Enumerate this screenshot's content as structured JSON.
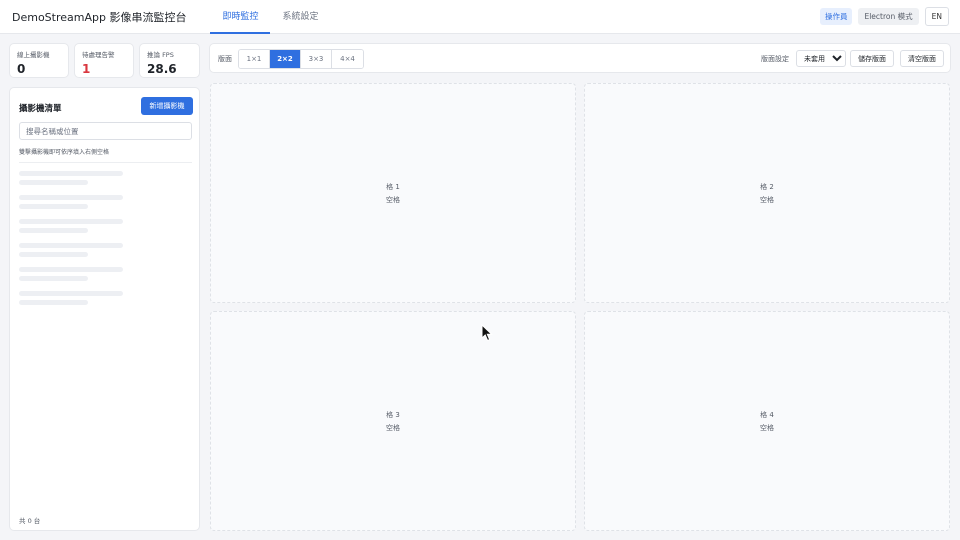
{
  "header": {
    "title": "DemoStreamApp 影像串流監控台",
    "tabs": [
      {
        "label": "即時監控",
        "active": true
      },
      {
        "label": "系統設定",
        "active": false
      }
    ],
    "role_badge": "操作員",
    "mode_badge": "Electron 模式",
    "lang_button": "EN"
  },
  "stats": [
    {
      "label": "線上攝影機",
      "value": "0"
    },
    {
      "label": "待處理告警",
      "value": "1"
    },
    {
      "label": "推論 FPS",
      "value": "28.6"
    }
  ],
  "camera_panel": {
    "title": "攝影機清單",
    "add_button": "新增攝影機",
    "search_placeholder": "搜尋名稱或位置",
    "hint": "雙擊攝影機即可依序填入右側空格",
    "count": "共 0 台"
  },
  "toolbar": {
    "layout_label": "版面",
    "layouts": [
      {
        "label": "1×1",
        "active": false
      },
      {
        "label": "2×2",
        "active": true
      },
      {
        "label": "3×3",
        "active": false
      },
      {
        "label": "4×4",
        "active": false
      }
    ],
    "preset_label": "版面設定",
    "preset_selected": "未套用",
    "save_button": "儲存版面",
    "clear_button": "清空版面"
  },
  "grid": [
    {
      "name": "格 1",
      "status": "空格"
    },
    {
      "name": "格 2",
      "status": "空格"
    },
    {
      "name": "格 3",
      "status": "空格"
    },
    {
      "name": "格 4",
      "status": "空格"
    }
  ],
  "colors": {
    "accent": "#2f6fe0",
    "alert": "#d9363e"
  }
}
